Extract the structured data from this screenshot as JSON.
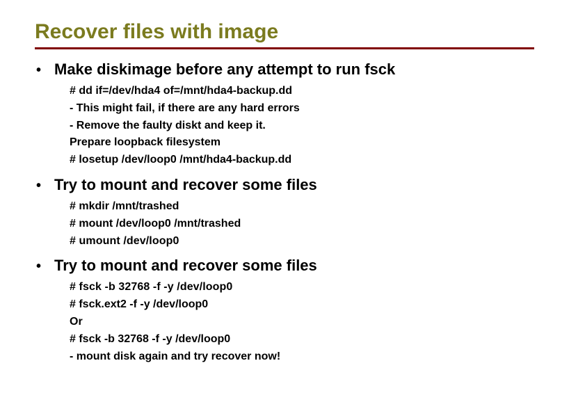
{
  "slide": {
    "title": "Recover files with image",
    "sections": [
      {
        "heading": "Make diskimage before any attempt to run fsck",
        "lines": [
          {
            "text": "# dd if=/dev/hda4 of=/mnt/hda4-backup.dd",
            "cls": "normal-font"
          },
          {
            "text": "-  This might fail, if there are any hard errors",
            "cls": "normal-font"
          },
          {
            "text": "-  Remove the faulty diskt and keep it.",
            "cls": "normal-font"
          },
          {
            "text": "Prepare loopback filesystem",
            "cls": "normal-font"
          },
          {
            "text": "# losetup /dev/loop0 /mnt/hda4-backup.dd",
            "cls": "normal-font"
          }
        ]
      },
      {
        "heading": "Try to mount and recover some files",
        "lines": [
          {
            "text": "# mkdir /mnt/trashed",
            "cls": "normal-font"
          },
          {
            "text": "# mount /dev/loop0 /mnt/trashed",
            "cls": "normal-font"
          },
          {
            "text": "# umount /dev/loop0",
            "cls": "alt-font"
          }
        ]
      },
      {
        "heading": "Try to mount and recover some files",
        "lines": [
          {
            "text": "# fsck -b 32768 -f -y /dev/loop0",
            "cls": "alt-font"
          },
          {
            "text": "# fsck.ext2 -f -y /dev/loop0",
            "cls": "normal-font"
          },
          {
            "text": "Or",
            "cls": "normal-font"
          },
          {
            "text": "# fsck -b 32768 -f -y /dev/loop0",
            "cls": "normal-font"
          },
          {
            "text": "- mount disk again and try recover now!",
            "cls": "normal-font"
          }
        ]
      }
    ]
  }
}
